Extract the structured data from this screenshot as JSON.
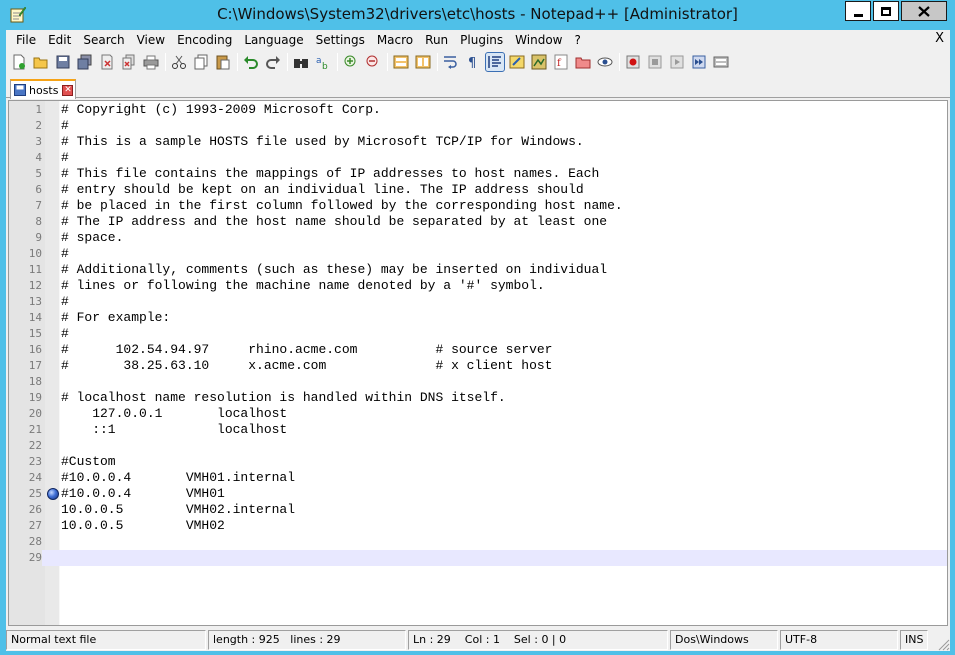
{
  "window": {
    "title": "C:\\Windows\\System32\\drivers\\etc\\hosts - Notepad++ [Administrator]"
  },
  "menu": {
    "items": [
      "File",
      "Edit",
      "Search",
      "View",
      "Encoding",
      "Language",
      "Settings",
      "Macro",
      "Run",
      "Plugins",
      "Window",
      "?"
    ],
    "close_label": "X"
  },
  "toolbar": {
    "icons": [
      "new-file",
      "open-file",
      "save",
      "save-all",
      "close",
      "close-all",
      "print",
      "cut",
      "copy",
      "paste",
      "undo",
      "redo",
      "find",
      "replace",
      "zoom-in",
      "zoom-out",
      "sync-vertical",
      "sync-horizontal",
      "word-wrap",
      "show-all-characters",
      "indent-guide",
      "user-defined-language",
      "doc-map",
      "function-list",
      "folder-as-workspace",
      "monitoring",
      "record-macro",
      "stop-recording",
      "play-macro",
      "run-macro-multiple",
      "save-macro"
    ]
  },
  "tabs": [
    {
      "label": "hosts",
      "active": true
    }
  ],
  "editor": {
    "lines": [
      "# Copyright (c) 1993-2009 Microsoft Corp.",
      "#",
      "# This is a sample HOSTS file used by Microsoft TCP/IP for Windows.",
      "#",
      "# This file contains the mappings of IP addresses to host names. Each",
      "# entry should be kept on an individual line. The IP address should",
      "# be placed in the first column followed by the corresponding host name.",
      "# The IP address and the host name should be separated by at least one",
      "# space.",
      "#",
      "# Additionally, comments (such as these) may be inserted on individual",
      "# lines or following the machine name denoted by a '#' symbol.",
      "#",
      "# For example:",
      "#",
      "#      102.54.94.97     rhino.acme.com          # source server",
      "#       38.25.63.10     x.acme.com              # x client host",
      "",
      "# localhost name resolution is handled within DNS itself.",
      "    127.0.0.1       localhost",
      "    ::1             localhost",
      "",
      "#Custom",
      "#10.0.0.4       VMH01.internal",
      "#10.0.0.4       VMH01",
      "10.0.0.5        VMH02.internal",
      "10.0.0.5        VMH02",
      "",
      ""
    ],
    "bookmark_line": 25,
    "current_line": 29
  },
  "status": {
    "file_type": "Normal text file",
    "length": "length : 925",
    "lines": "lines : 29",
    "position": "Ln : 29    Col : 1    Sel : 0 | 0",
    "eol": "Dos\\Windows",
    "encoding": "UTF-8",
    "mode": "INS"
  },
  "colors": {
    "titlebar": "#4fc0e8",
    "tab_accent": "#f6a317",
    "current_line": "#e8e8ff"
  }
}
